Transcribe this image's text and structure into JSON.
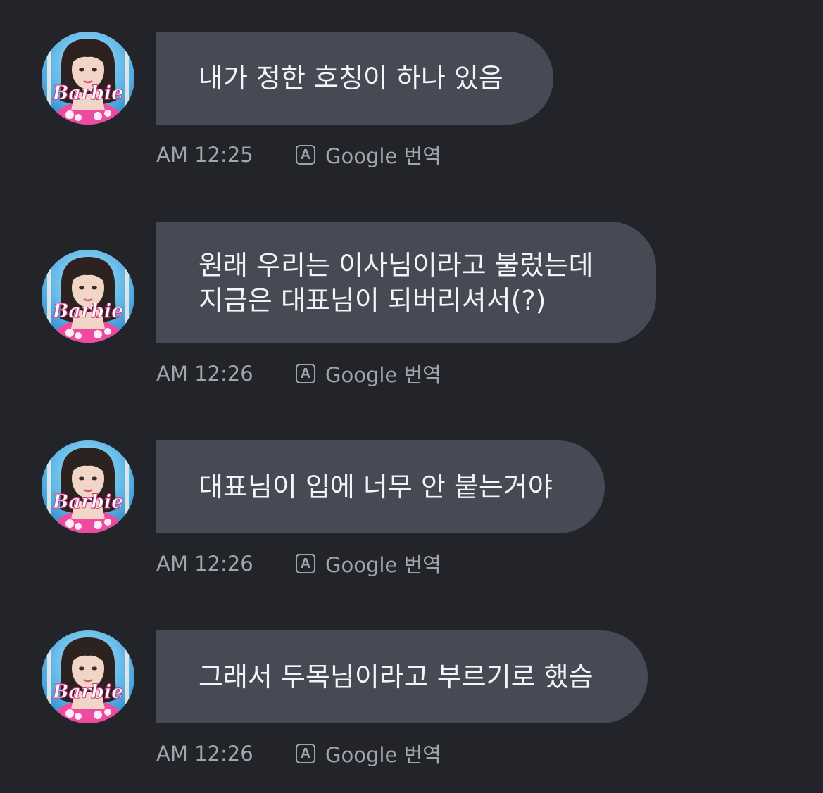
{
  "theme": {
    "background": "#232429",
    "bubble": "#474a55",
    "text": "#f4f4f6",
    "meta_text": "#a3a5ad",
    "avatar_accent": "#e8449a"
  },
  "avatar": {
    "logo_text": "Barbie"
  },
  "messages": [
    {
      "text": "내가 정한 호칭이 하나 있음",
      "time": "AM 12:25",
      "translate_icon": "A",
      "translate_label": "Google 번역"
    },
    {
      "text": "원래 우리는 이사님이라고 불렀는데\n지금은 대표님이 되버리셔서(?)",
      "time": "AM 12:26",
      "translate_icon": "A",
      "translate_label": "Google 번역"
    },
    {
      "text": "대표님이 입에 너무 안 붙는거야",
      "time": "AM 12:26",
      "translate_icon": "A",
      "translate_label": "Google 번역"
    },
    {
      "text": "그래서 두목님이라고 부르기로 했슴",
      "time": "AM 12:26",
      "translate_icon": "A",
      "translate_label": "Google 번역"
    }
  ]
}
